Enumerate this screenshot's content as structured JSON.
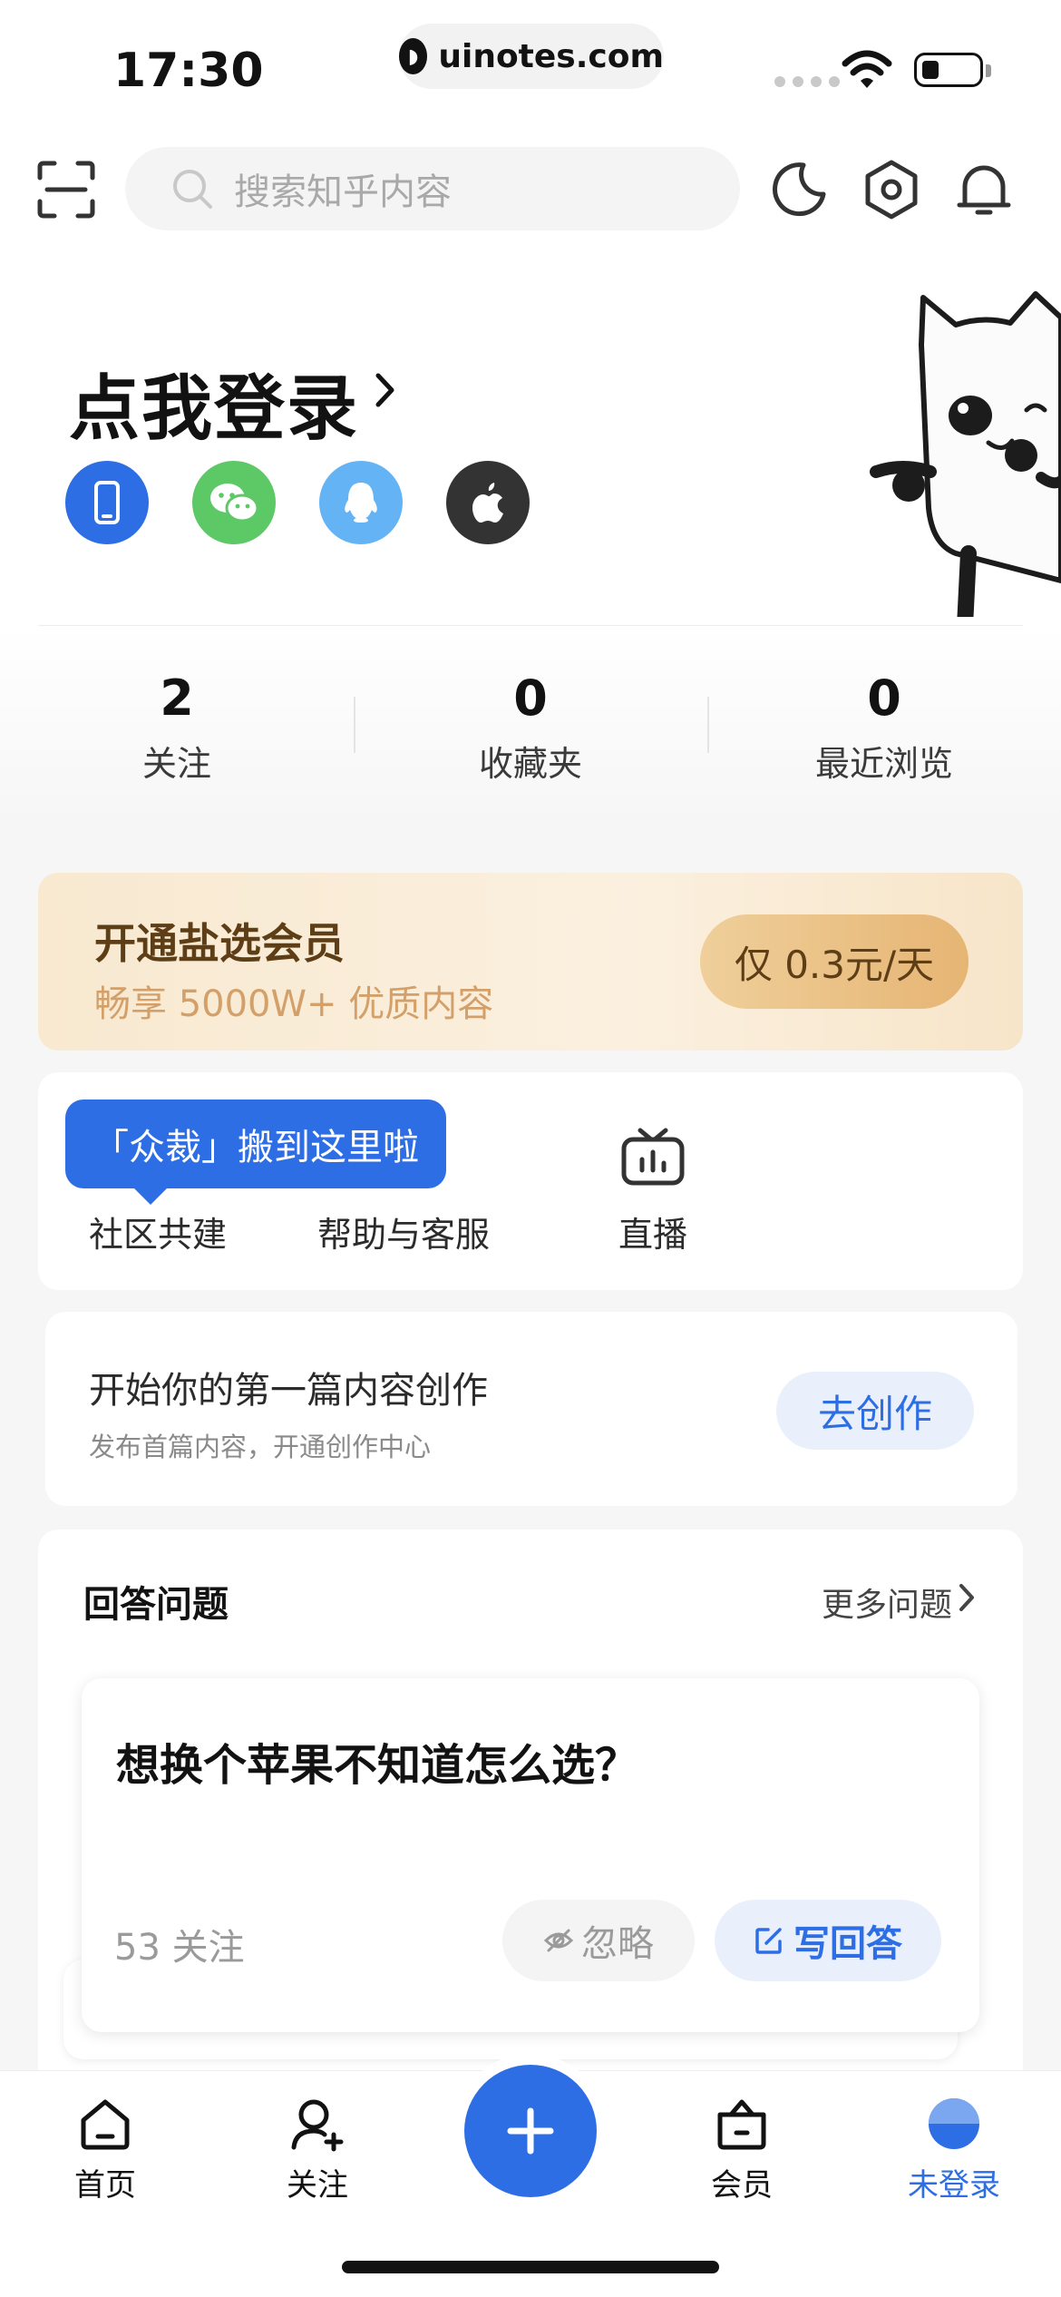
{
  "status_bar": {
    "time": "17:30",
    "url": "uinotes.com"
  },
  "search": {
    "placeholder": "搜索知乎内容"
  },
  "icons": {
    "scan": "scan-icon",
    "search": "search-icon",
    "moon": "moon-icon",
    "settings": "hexagon-settings-icon",
    "bell": "bell-icon",
    "phone": "phone-icon",
    "wechat": "wechat-icon",
    "qq": "qq-icon",
    "apple": "apple-icon"
  },
  "header": {
    "login_title": "点我登录",
    "social_colors": {
      "phone": "#2e6ee4",
      "wechat": "#5dc866",
      "qq": "#64b4f5",
      "apple": "#333333"
    }
  },
  "stats": [
    {
      "value": "2",
      "label": "关注"
    },
    {
      "value": "0",
      "label": "收藏夹"
    },
    {
      "value": "0",
      "label": "最近浏览"
    }
  ],
  "vip": {
    "title": "开通盐选会员",
    "subtitle": "畅享 5000W+ 优质内容",
    "price_button": "仅 0.3元/天"
  },
  "tools": {
    "tooltip": "「众裁」搬到这里啦",
    "items": [
      "社区共建",
      "帮助与客服",
      "直播"
    ]
  },
  "create": {
    "title": "开始你的第一篇内容创作",
    "subtitle": "发布首篇内容，开通创作中心",
    "button": "去创作"
  },
  "answer": {
    "title": "回答问题",
    "more": "更多问题",
    "question": "想换个苹果不知道怎么选？",
    "followers": "53 关注",
    "ignore": "忽略",
    "write": "写回答"
  },
  "nav": {
    "items": [
      "首页",
      "关注",
      "会员",
      "未登录"
    ],
    "accent": "#2e6ee4"
  }
}
